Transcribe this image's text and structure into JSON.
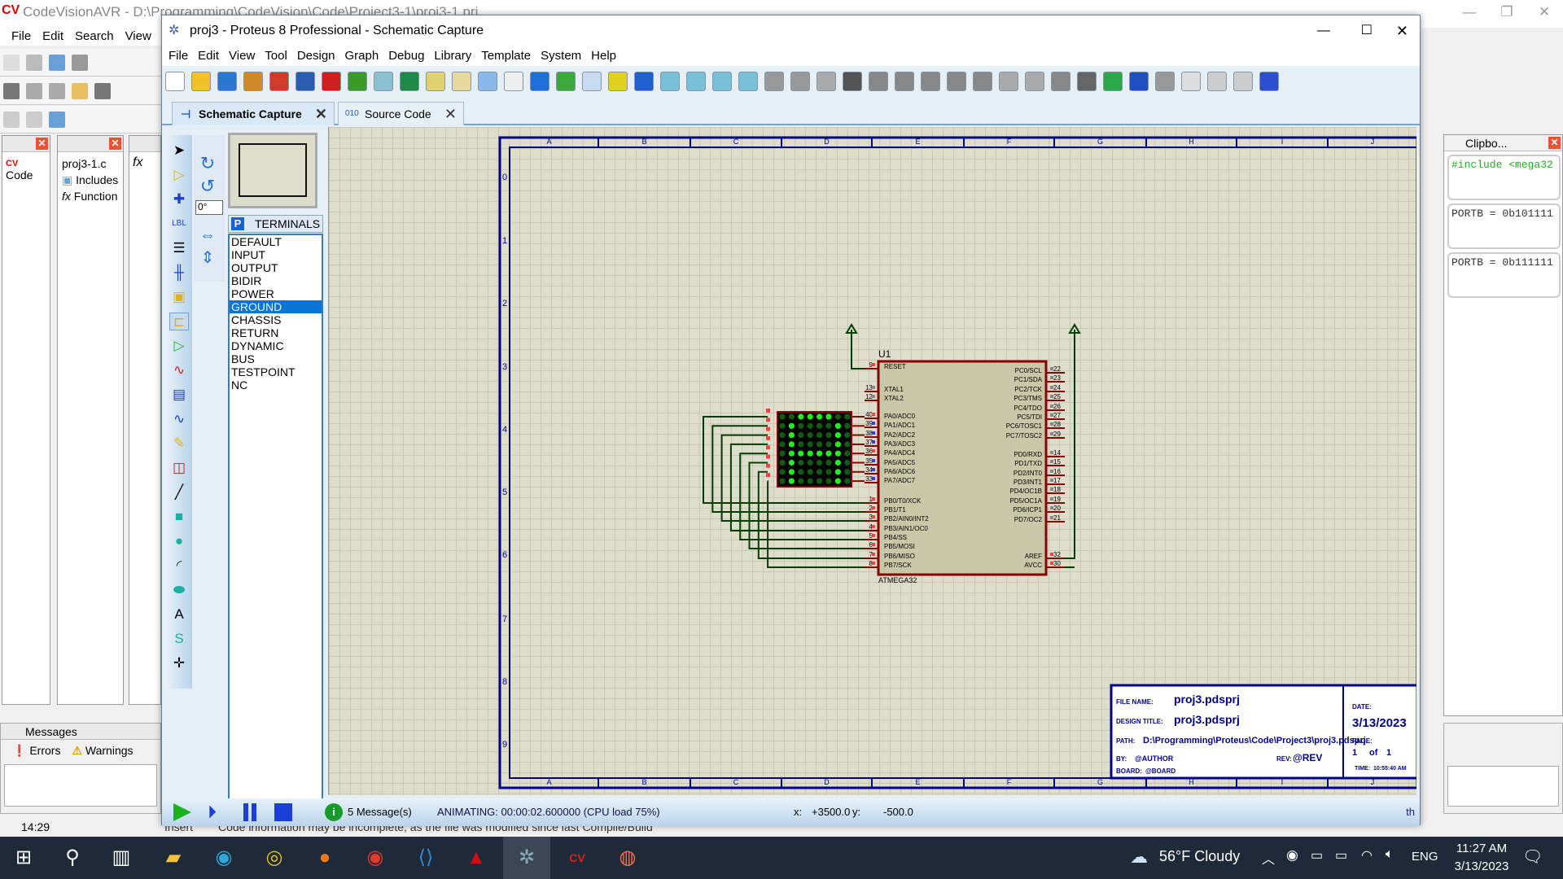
{
  "codevision": {
    "title": "CodeVisionAVR - D:\\Programming\\CodeVision\\Code\\Project3-1\\proj3-1.prj",
    "logo": "CV AVR",
    "menu": [
      "File",
      "Edit",
      "Search",
      "View"
    ],
    "panels": {
      "code_nav": "Code",
      "file": "proj3-1.c",
      "includes": "Includes",
      "functions": "Function",
      "fx": "fx"
    },
    "clipboard": {
      "title": "Clipbo...",
      "items": [
        "#include <mega32",
        "PORTB = 0b101111",
        "PORTB = 0b111111"
      ]
    },
    "messages": {
      "title": "Messages",
      "tabs": [
        "Errors",
        "Warnings"
      ]
    },
    "status": {
      "line": "14:29",
      "mode": "Insert",
      "info": "Code information may be incomplete, as the file was modified since last Compile/Build"
    }
  },
  "proteus": {
    "title": "proj3 - Proteus 8 Professional - Schematic Capture",
    "menu": [
      "File",
      "Edit",
      "View",
      "Tool",
      "Design",
      "Graph",
      "Debug",
      "Library",
      "Template",
      "System",
      "Help"
    ],
    "toolbar": [
      "new-file",
      "open-folder",
      "save",
      "import",
      "home",
      "schematic",
      "pcb",
      "3d-view",
      "gerber",
      "bom",
      "pcb-layout",
      "bill-dollar",
      "source-code",
      "report",
      "help",
      "refresh",
      "grid",
      "origin",
      "pan",
      "zoom-in",
      "zoom-out",
      "zoom-all",
      "zoom-area",
      "undo",
      "redo",
      "cut",
      "copy",
      "paste",
      "block-copy",
      "block-move",
      "block-rotate",
      "block-delete",
      "pick-device",
      "make-device",
      "packaging",
      "decompose",
      "wire-autorouter",
      "search",
      "property-assign",
      "new-sheet",
      "delete-sheet",
      "goto-sheet",
      "netlist"
    ],
    "tabs": [
      {
        "label": "Schematic Capture",
        "active": true
      },
      {
        "label": "Source Code",
        "active": false
      }
    ],
    "rotation": "0°",
    "terminals": {
      "header": "TERMINALS",
      "badge": "P",
      "items": [
        "DEFAULT",
        "INPUT",
        "OUTPUT",
        "BIDIR",
        "POWER",
        "GROUND",
        "CHASSIS",
        "RETURN",
        "DYNAMIC",
        "BUS",
        "TESTPOINT",
        "NC"
      ],
      "selected": "GROUND"
    },
    "sheet": {
      "columns": [
        "A",
        "B",
        "C",
        "D",
        "E",
        "F",
        "G",
        "H",
        "I",
        "J"
      ],
      "rows": [
        "0",
        "1",
        "2",
        "3",
        "4",
        "5",
        "6",
        "7",
        "8",
        "9"
      ]
    },
    "chip": {
      "ref": "U1",
      "part": "ATMEGA32",
      "left_pins": [
        {
          "n": "9",
          "name": "RESET"
        },
        {
          "n": "13",
          "name": "XTAL1"
        },
        {
          "n": "12",
          "name": "XTAL2"
        },
        {
          "n": "40",
          "name": "PA0/ADC0"
        },
        {
          "n": "39",
          "name": "PA1/ADC1"
        },
        {
          "n": "38",
          "name": "PA2/ADC2"
        },
        {
          "n": "37",
          "name": "PA3/ADC3"
        },
        {
          "n": "36",
          "name": "PA4/ADC4"
        },
        {
          "n": "35",
          "name": "PA5/ADC5"
        },
        {
          "n": "34",
          "name": "PA6/ADC6"
        },
        {
          "n": "33",
          "name": "PA7/ADC7"
        },
        {
          "n": "1",
          "name": "PB0/T0/XCK"
        },
        {
          "n": "2",
          "name": "PB1/T1"
        },
        {
          "n": "3",
          "name": "PB2/AIN0/INT2"
        },
        {
          "n": "4",
          "name": "PB3/AIN1/OC0"
        },
        {
          "n": "5",
          "name": "PB4/SS"
        },
        {
          "n": "6",
          "name": "PB5/MOSI"
        },
        {
          "n": "7",
          "name": "PB6/MISO"
        },
        {
          "n": "8",
          "name": "PB7/SCK"
        }
      ],
      "right_pins": [
        {
          "n": "22",
          "name": "PC0/SCL"
        },
        {
          "n": "23",
          "name": "PC1/SDA"
        },
        {
          "n": "24",
          "name": "PC2/TCK"
        },
        {
          "n": "25",
          "name": "PC3/TMS"
        },
        {
          "n": "26",
          "name": "PC4/TDO"
        },
        {
          "n": "27",
          "name": "PC5/TDI"
        },
        {
          "n": "28",
          "name": "PC6/TOSC1"
        },
        {
          "n": "29",
          "name": "PC7/TOSC2"
        },
        {
          "n": "14",
          "name": "PD0/RXD"
        },
        {
          "n": "15",
          "name": "PD1/TXD"
        },
        {
          "n": "16",
          "name": "PD2/INT0"
        },
        {
          "n": "17",
          "name": "PD3/INT1"
        },
        {
          "n": "18",
          "name": "PD4/OC1B"
        },
        {
          "n": "19",
          "name": "PD5/OC1A"
        },
        {
          "n": "20",
          "name": "PD6/ICP1"
        },
        {
          "n": "21",
          "name": "PD7/OC2"
        },
        {
          "n": "32",
          "name": "AREF"
        },
        {
          "n": "30",
          "name": "AVCC"
        }
      ]
    },
    "led_matrix": {
      "lit": [
        "00111100",
        "01000010",
        "01000010",
        "01000010",
        "01111110",
        "01000010",
        "01000010",
        "01000010"
      ],
      "on_color": "#22ee22",
      "off_color": "#135a13"
    },
    "title_block": {
      "file_name_label": "FILE NAME:",
      "file_name": "proj3.pdsprj",
      "design_title_label": "DESIGN TITLE:",
      "design_title": "proj3.pdsprj",
      "path_label": "PATH:",
      "path": "D:\\Programming\\Proteus\\Code\\Project3\\proj3.pdsprj",
      "by_label": "BY:",
      "author": "@AUTHOR",
      "rev_label": "REV:",
      "rev": "@REV",
      "board_label": "BOARD:",
      "board": "@BOARD",
      "date_label": "DATE:",
      "date": "3/13/2023",
      "page_label": "PAGE:",
      "page": "1",
      "of": "of",
      "pages": "1",
      "time_label": "TIME:",
      "time": "10:55:40 AM"
    },
    "status": {
      "messages": "5 Message(s)",
      "animating": "ANIMATING: 00:00:02.600000 (CPU load 75%)",
      "x_label": "x:",
      "x": "+3500.0",
      "y_label": "y:",
      "y": "-500.0",
      "units": "th"
    }
  },
  "taskbar": {
    "weather": "56°F  Cloudy",
    "lang": "ENG",
    "time": "11:27 AM",
    "date": "3/13/2023"
  }
}
